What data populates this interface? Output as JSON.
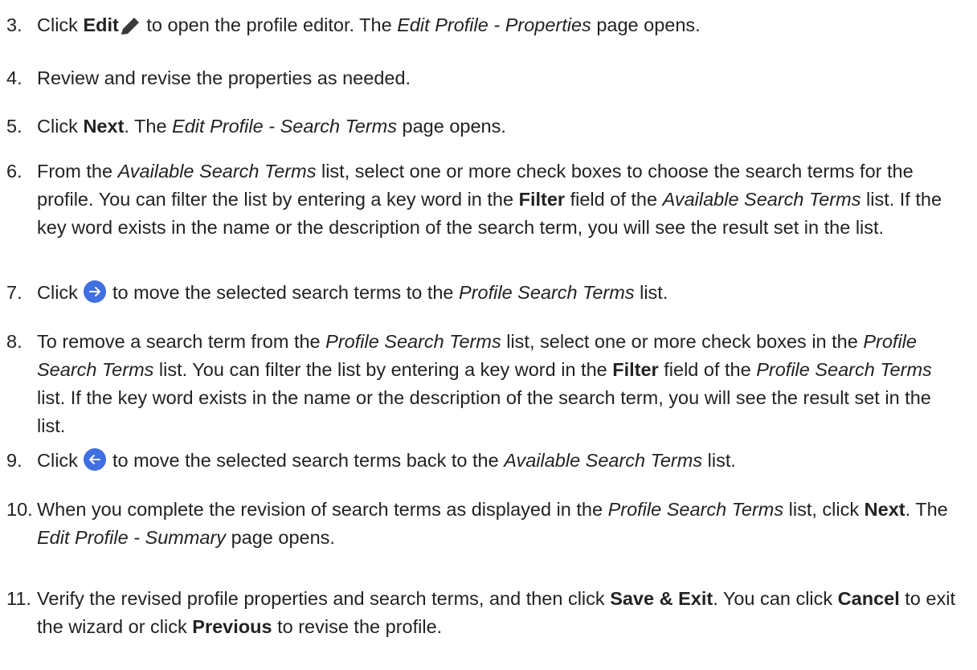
{
  "steps": [
    {
      "number": "3.",
      "parts": [
        {
          "t": "text",
          "v": "Click "
        },
        {
          "t": "b",
          "v": "Edit"
        },
        {
          "t": "icon",
          "name": "pencil-icon"
        },
        {
          "t": "text",
          "v": " to open the profile editor. The "
        },
        {
          "t": "i",
          "v": "Edit Profile - Properties"
        },
        {
          "t": "text",
          "v": " page opens."
        }
      ]
    },
    {
      "number": "4.",
      "parts": [
        {
          "t": "text",
          "v": "Review and revise the properties as needed."
        }
      ]
    },
    {
      "number": "5.",
      "parts": [
        {
          "t": "text",
          "v": "Click "
        },
        {
          "t": "b",
          "v": "Next"
        },
        {
          "t": "text",
          "v": ". The "
        },
        {
          "t": "i",
          "v": "Edit Profile - Search Terms"
        },
        {
          "t": "text",
          "v": " page opens."
        }
      ]
    },
    {
      "number": "6.",
      "parts": [
        {
          "t": "text",
          "v": "From the "
        },
        {
          "t": "i",
          "v": "Available Search Terms"
        },
        {
          "t": "text",
          "v": " list, select one or more check boxes to choose the search terms for the profile. You can filter the list by entering a key word in the "
        },
        {
          "t": "b",
          "v": "Filter"
        },
        {
          "t": "text",
          "v": " field of the "
        },
        {
          "t": "i",
          "v": "Available Search Terms"
        },
        {
          "t": "text",
          "v": " list. If the key word exists in the name or the description of the search term, you will see the result set in the list."
        }
      ]
    },
    {
      "number": "7.",
      "parts": [
        {
          "t": "text",
          "v": "Click "
        },
        {
          "t": "icon",
          "name": "arrow-right-circle-icon"
        },
        {
          "t": "text",
          "v": " to move the selected search terms to the "
        },
        {
          "t": "i",
          "v": "Profile Search Terms"
        },
        {
          "t": "text",
          "v": " list."
        }
      ]
    },
    {
      "number": "8.",
      "parts": [
        {
          "t": "text",
          "v": "To remove a search term from the "
        },
        {
          "t": "i",
          "v": "Profile Search Terms"
        },
        {
          "t": "text",
          "v": " list, select one or more check boxes in the "
        },
        {
          "t": "i",
          "v": "Profile Search Terms"
        },
        {
          "t": "text",
          "v": " list. You can filter the list by entering a key word in the "
        },
        {
          "t": "b",
          "v": "Filter"
        },
        {
          "t": "text",
          "v": " field of the "
        },
        {
          "t": "i",
          "v": "Profile Search Terms"
        },
        {
          "t": "text",
          "v": " list. If the key word exists in the name or the description of the search term, you will see the result set in the list."
        }
      ]
    },
    {
      "number": "9.",
      "parts": [
        {
          "t": "text",
          "v": "Click "
        },
        {
          "t": "icon",
          "name": "arrow-left-circle-icon"
        },
        {
          "t": "text",
          "v": " to move the selected search terms back to the "
        },
        {
          "t": "i",
          "v": "Available Search Terms"
        },
        {
          "t": "text",
          "v": " list."
        }
      ]
    },
    {
      "number": "10.",
      "parts": [
        {
          "t": "text",
          "v": "When you complete the revision of search terms as displayed in the "
        },
        {
          "t": "i",
          "v": "Profile Search Terms"
        },
        {
          "t": "text",
          "v": " list, click "
        },
        {
          "t": "b",
          "v": "Next"
        },
        {
          "t": "text",
          "v": ". The "
        },
        {
          "t": "i",
          "v": "Edit Profile - Summary"
        },
        {
          "t": "text",
          "v": " page opens."
        }
      ]
    },
    {
      "number": "11.",
      "parts": [
        {
          "t": "text",
          "v": "Verify the revised profile properties and search terms, and then click "
        },
        {
          "t": "b",
          "v": "Save & Exit"
        },
        {
          "t": "text",
          "v": ". You can click "
        },
        {
          "t": "b",
          "v": "Cancel"
        },
        {
          "t": "text",
          "v": " to exit the wizard or click "
        },
        {
          "t": "b",
          "v": "Previous"
        },
        {
          "t": "text",
          "v": " to revise the profile."
        }
      ]
    }
  ],
  "colors": {
    "text": "#222222",
    "icon_blue": "#3f6fe0",
    "icon_dark": "#3a3a3a"
  }
}
